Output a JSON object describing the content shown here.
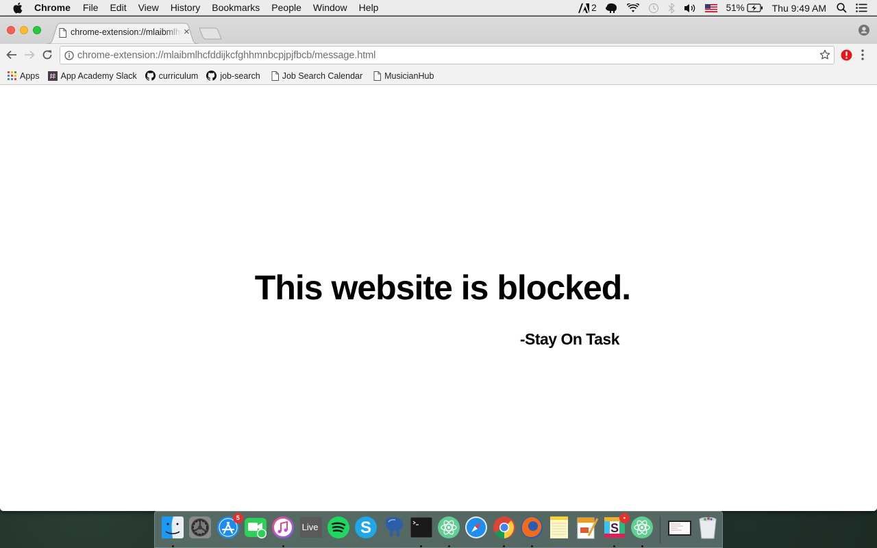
{
  "menubar": {
    "app_name": "Chrome",
    "items": [
      "File",
      "Edit",
      "View",
      "History",
      "Bookmarks",
      "People",
      "Window",
      "Help"
    ],
    "status": {
      "adobe_count": "2",
      "battery": "51%",
      "clock": "Thu 9:49 AM"
    }
  },
  "browser": {
    "tab": {
      "title": "chrome-extension://mlaibmlhcfddijkcfghhmnbcpjpjfbcb/message.html",
      "close": "×"
    },
    "omnibox": {
      "url": "chrome-extension://mlaibmlhcfddijkcfghhmnbcpjpjfbcb/message.html"
    },
    "bookmarks": [
      {
        "label": "Apps",
        "icon": "apps-grid-icon"
      },
      {
        "label": "App Academy Slack",
        "icon": "slack-hash-icon"
      },
      {
        "label": "curriculum",
        "icon": "github-icon"
      },
      {
        "label": "job-search",
        "icon": "github-icon"
      },
      {
        "label": "Job Search Calendar",
        "icon": "page-icon"
      },
      {
        "label": "MusicianHub",
        "icon": "page-icon"
      }
    ],
    "extension_badge": "!"
  },
  "page": {
    "headline": "This website is blocked.",
    "signature": "-Stay On Task"
  },
  "dock": {
    "items": [
      {
        "name": "Finder",
        "running": true
      },
      {
        "name": "System Preferences",
        "running": false
      },
      {
        "name": "App Store",
        "running": false,
        "badge": "5"
      },
      {
        "name": "FaceTime",
        "running": false
      },
      {
        "name": "iTunes",
        "running": true
      },
      {
        "name": "Live",
        "label": "Live",
        "running": false
      },
      {
        "name": "Spotify",
        "running": false
      },
      {
        "name": "Skype",
        "running": false
      },
      {
        "name": "Postgres",
        "running": false
      },
      {
        "name": "Terminal",
        "running": true
      },
      {
        "name": "Atom",
        "running": true
      },
      {
        "name": "Safari",
        "running": false
      },
      {
        "name": "Chrome",
        "running": true
      },
      {
        "name": "Firefox",
        "running": true
      },
      {
        "name": "Notes",
        "running": false
      },
      {
        "name": "Pages",
        "running": false
      },
      {
        "name": "Slack",
        "running": true,
        "badge": "•"
      },
      {
        "name": "Atom Beta",
        "running": true
      },
      {
        "name": "Screenshot Preview",
        "running": false
      },
      {
        "name": "Trash",
        "running": false
      }
    ]
  }
}
